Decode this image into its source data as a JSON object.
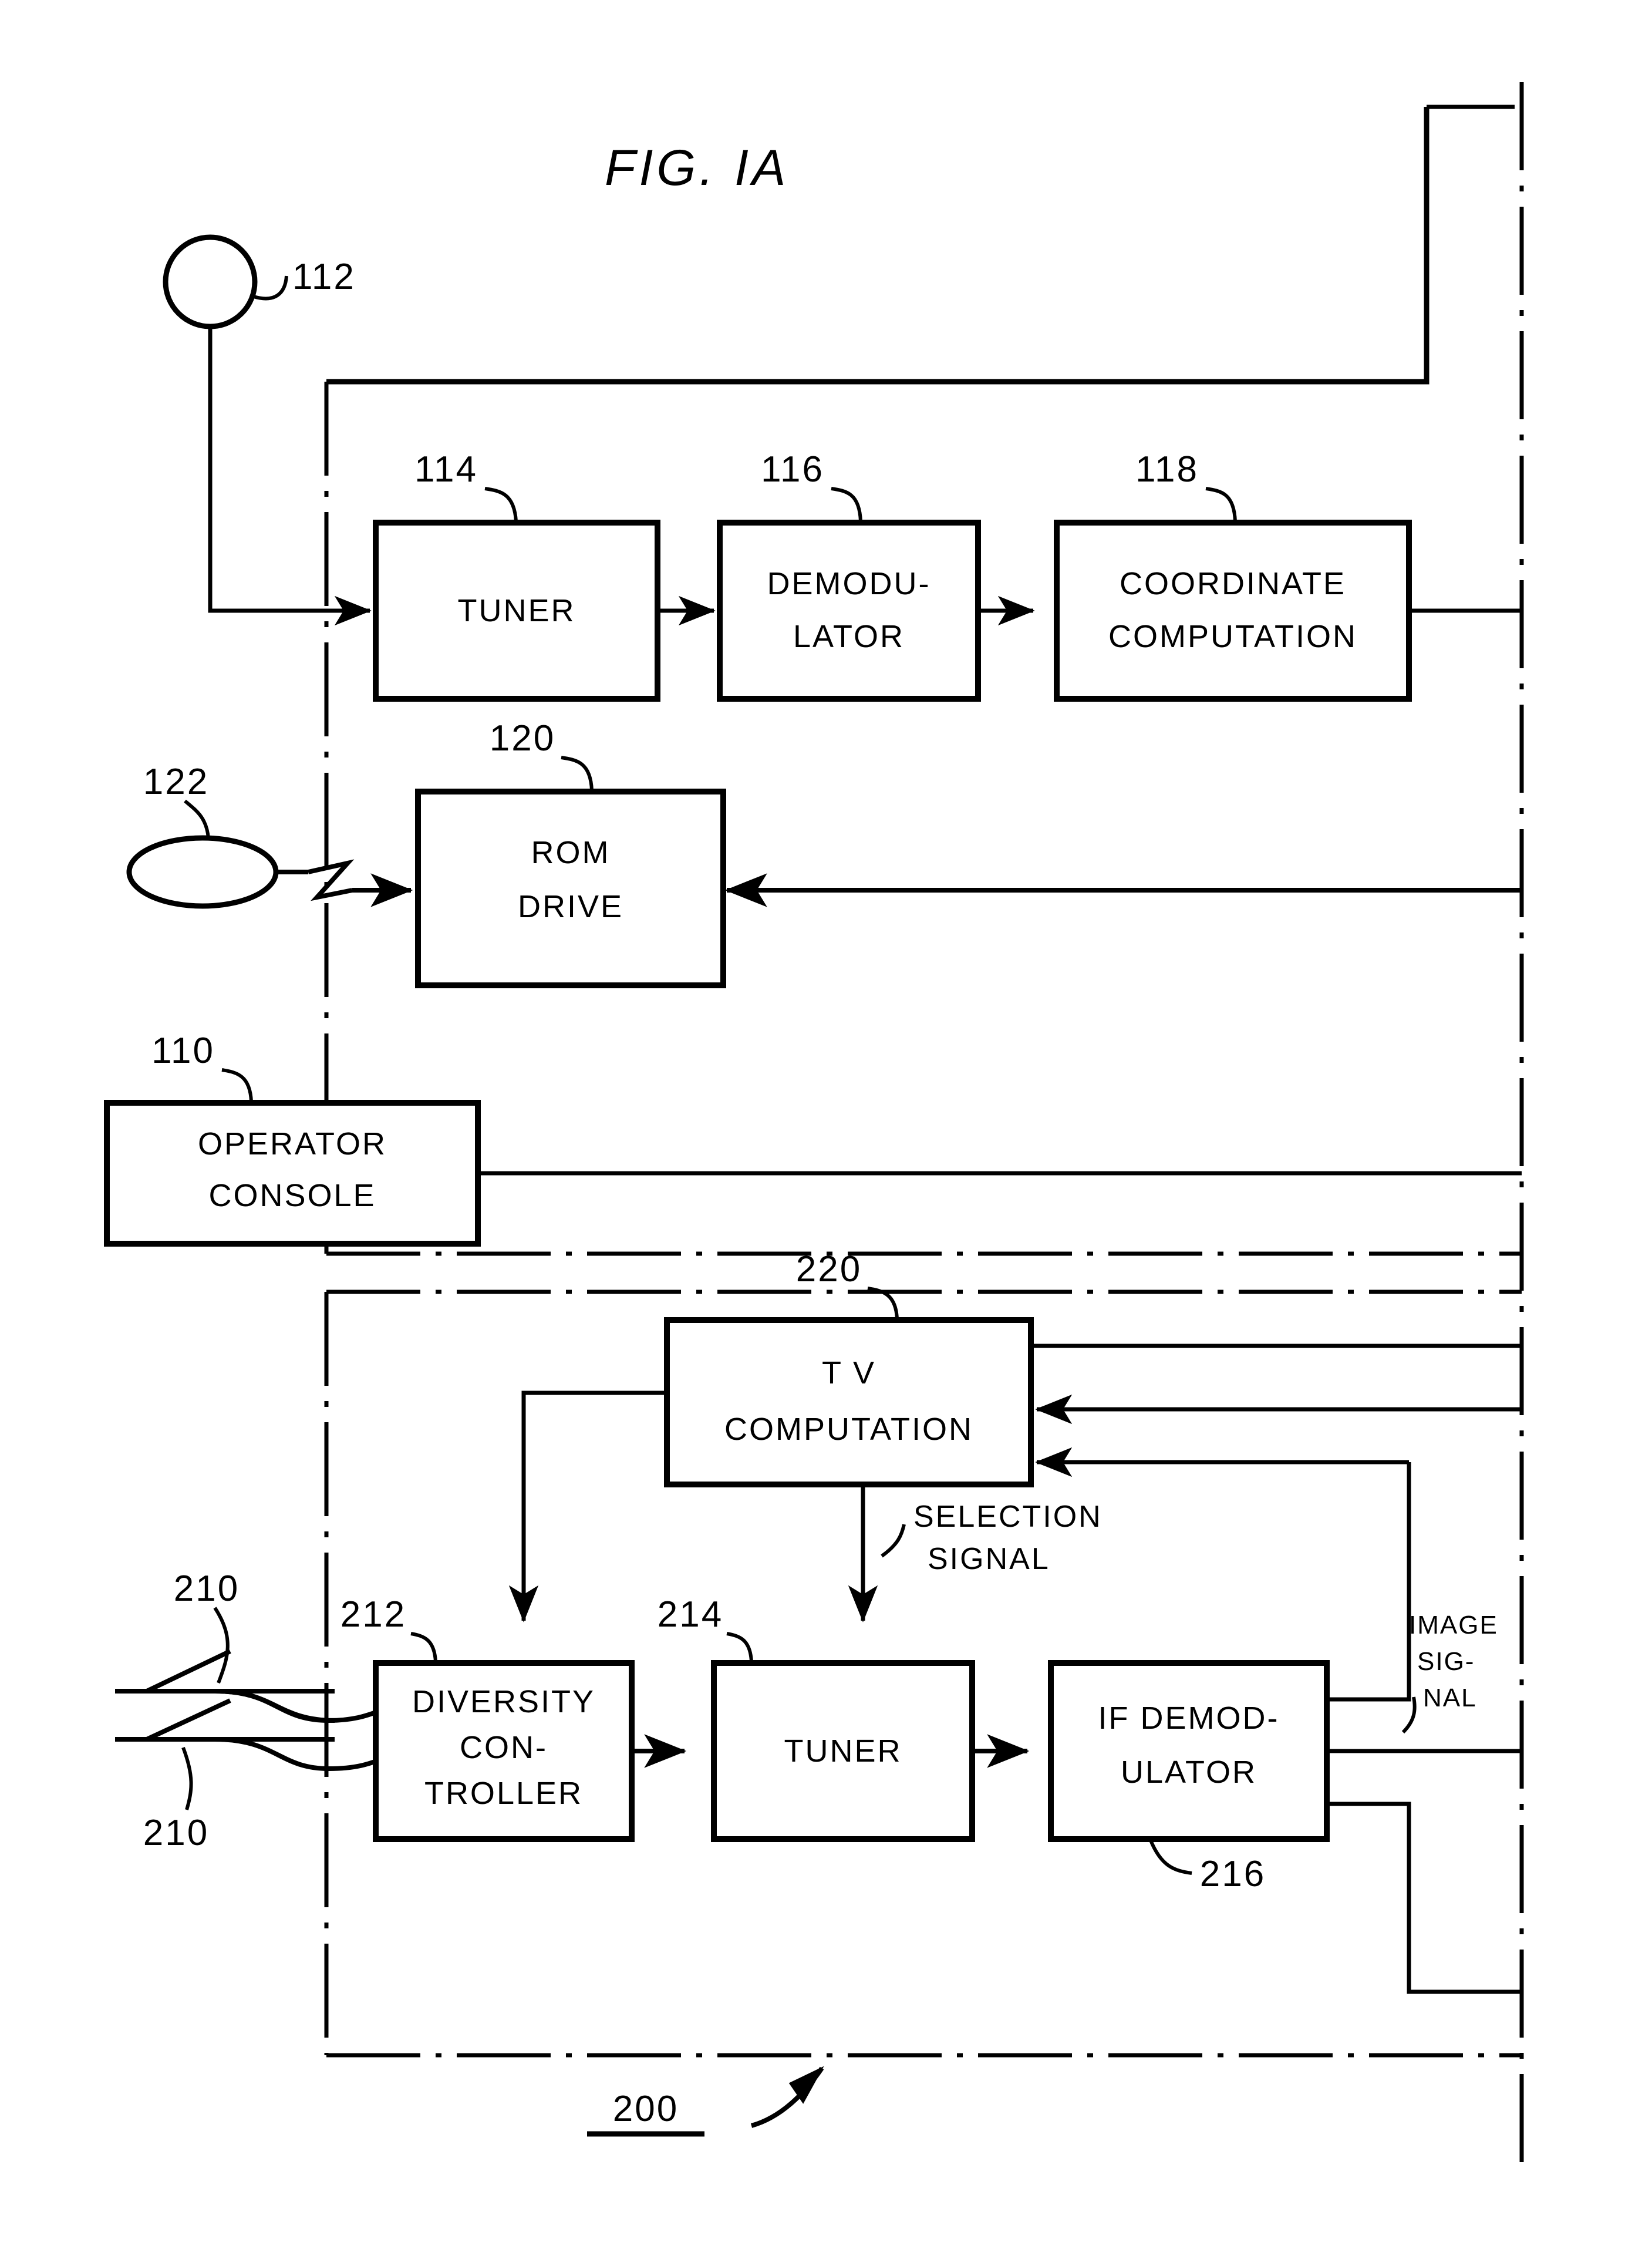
{
  "figure": {
    "title": "FIG. IA",
    "domain": "patent-block-diagram"
  },
  "blocks": [
    {
      "id": "tuner_top",
      "ref": "114",
      "lines": [
        "TUNER"
      ]
    },
    {
      "id": "demodulator",
      "ref": "116",
      "lines": [
        "DEMODU-",
        "LATOR"
      ]
    },
    {
      "id": "coordinate",
      "ref": "118",
      "lines": [
        "COORDINATE",
        "COMPUTATION"
      ]
    },
    {
      "id": "rom_drive",
      "ref": "120",
      "lines": [
        "ROM",
        "DRIVE"
      ]
    },
    {
      "id": "operator",
      "ref": "110",
      "lines": [
        "OPERATOR",
        "CONSOLE"
      ]
    },
    {
      "id": "tv_comp",
      "ref": "220",
      "lines": [
        "T V",
        "COMPUTATION"
      ]
    },
    {
      "id": "diversity",
      "ref": "212",
      "lines": [
        "DIVERSITY",
        "CON-",
        "TROLLER"
      ]
    },
    {
      "id": "tuner_bottom",
      "ref": "214",
      "lines": [
        "TUNER"
      ]
    },
    {
      "id": "if_demod",
      "ref": "216",
      "lines": [
        "IF DEMOD-",
        "ULATOR"
      ]
    }
  ],
  "symbols": [
    {
      "id": "gps_antenna",
      "ref": "112",
      "shape": "circle"
    },
    {
      "id": "rom_disc",
      "ref": "122",
      "shape": "ellipse"
    },
    {
      "id": "tv_antenna_upper",
      "ref": "210",
      "shape": "whip-antenna"
    },
    {
      "id": "tv_antenna_lower",
      "ref": "210",
      "shape": "whip-antenna"
    }
  ],
  "signal_labels": [
    {
      "id": "selection_signal",
      "lines": [
        "SELECTION",
        "SIGNAL"
      ]
    },
    {
      "id": "image_signal",
      "lines": [
        "IMAGE",
        "SIG-",
        "NAL"
      ]
    }
  ],
  "group_refs": [
    {
      "id": "tv_receiver_group",
      "ref": "200",
      "underlined": true
    }
  ],
  "refs": {
    "r110": "110",
    "r112": "112",
    "r114": "114",
    "r116": "116",
    "r118": "118",
    "r120": "120",
    "r122": "122",
    "r200": "200",
    "r210a": "210",
    "r210b": "210",
    "r212": "212",
    "r214": "214",
    "r216": "216",
    "r220": "220"
  },
  "text": {
    "tuner": "TUNER",
    "demod_l1": "DEMODU-",
    "demod_l2": "LATOR",
    "coord_l1": "COORDINATE",
    "coord_l2": "COMPUTATION",
    "rom_l1": "ROM",
    "rom_l2": "DRIVE",
    "oper_l1": "OPERATOR",
    "oper_l2": "CONSOLE",
    "tv_l1": "T V",
    "tv_l2": "COMPUTATION",
    "div_l1": "DIVERSITY",
    "div_l2": "CON-",
    "div_l3": "TROLLER",
    "tuner2": "TUNER",
    "ifd_l1": "IF  DEMOD-",
    "ifd_l2": "ULATOR",
    "sel_l1": "SELECTION",
    "sel_l2": "SIGNAL",
    "img_l1": "IMAGE",
    "img_l2": "SIG-",
    "img_l3": "NAL"
  },
  "colors": {
    "ink": "#000000",
    "paper": "#ffffff"
  }
}
